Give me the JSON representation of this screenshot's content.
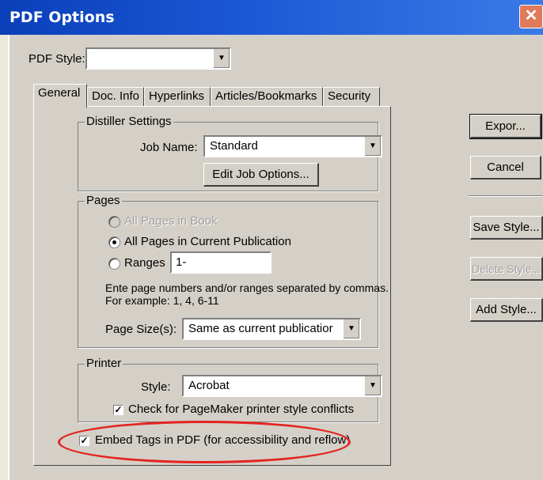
{
  "window": {
    "title": "PDF Options",
    "close_glyph": "✕"
  },
  "pdf_style": {
    "label": "PDF Style:",
    "value": ""
  },
  "tabs": [
    "General",
    "Doc. Info",
    "Hyperlinks",
    "Articles/Bookmarks",
    "Security"
  ],
  "distiller": {
    "legend": "Distiller Settings",
    "job_name_label": "Job Name:",
    "job_name_value": "Standard",
    "edit_button": "Edit Job Options..."
  },
  "pages": {
    "legend": "Pages",
    "all_in_book": "All Pages in Book",
    "all_in_publication": "All Pages in Current Publication",
    "ranges_label": "Ranges",
    "ranges_value": "1-",
    "hint_line1": "Ente page numbers and/or ranges separated by commas.",
    "hint_line2": "For example: 1, 4, 6-11",
    "page_size_label": "Page Size(s):",
    "page_size_value": "Same as current publicatior"
  },
  "printer": {
    "legend": "Printer",
    "style_label": "Style:",
    "style_value": "Acrobat",
    "check_conflicts": "Check for PageMaker printer style conflicts"
  },
  "embed_tags": {
    "label": "Embed Tags in PDF (for accessibility and reflow)",
    "checked": true
  },
  "buttons": {
    "export": "Expor...",
    "cancel": "Cancel",
    "save_style": "Save Style...",
    "delete_style": "Delete Style...",
    "add_style": "Add Style..."
  },
  "colors": {
    "title_bar": "#1b58d6",
    "dialog_bg": "#d4d0c8",
    "highlight": "#e3241f"
  }
}
